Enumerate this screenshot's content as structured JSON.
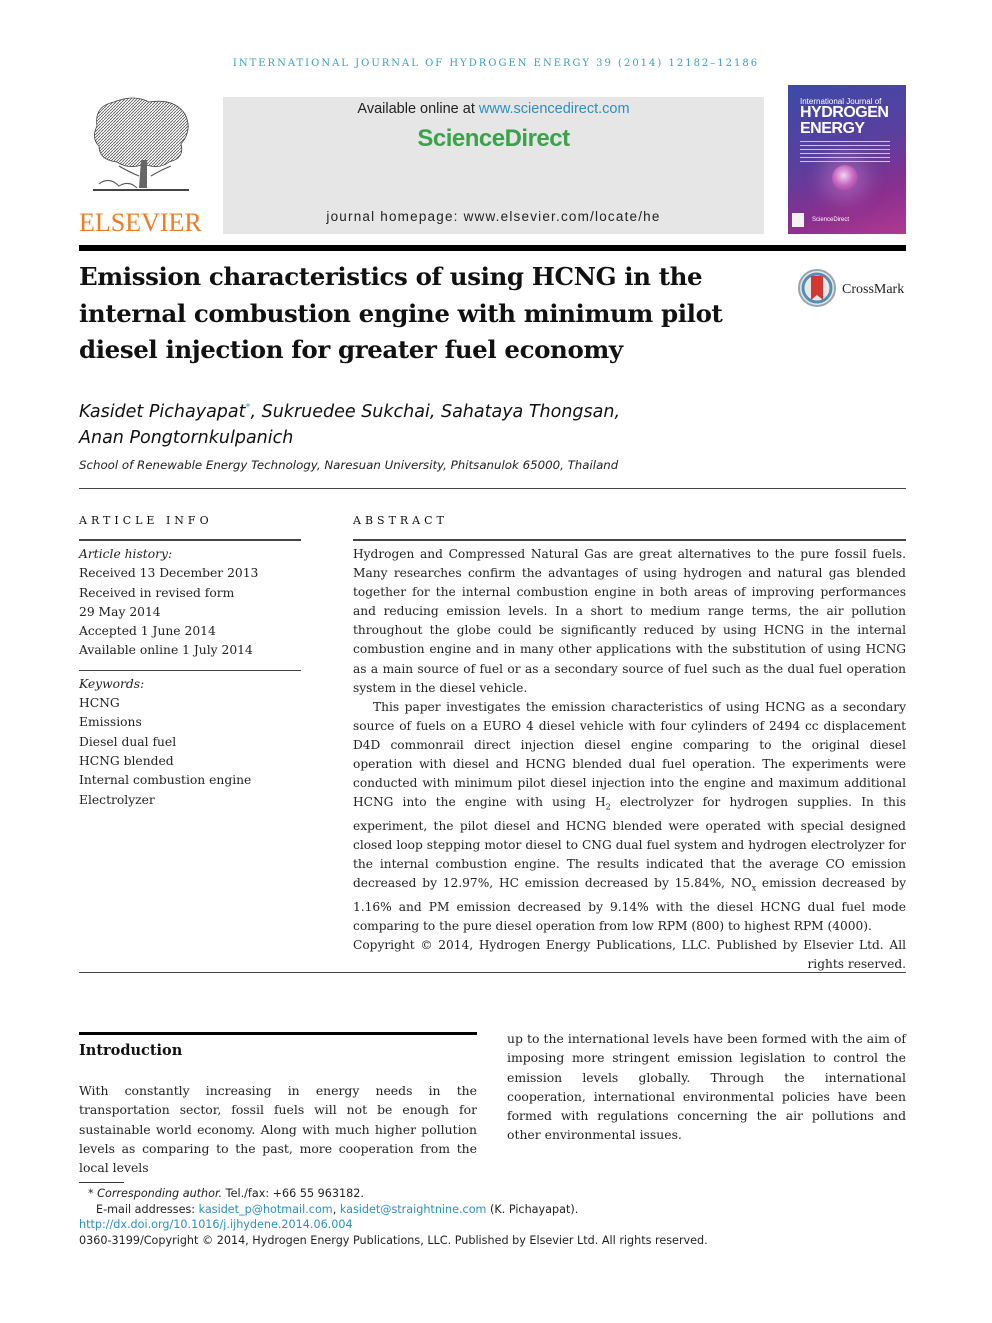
{
  "running_head": "International Journal of Hydrogen Energy 39 (2014) 12182–12186",
  "publisher": {
    "logo_word": "ELSEVIER",
    "available_online_prefix": "Available online at ",
    "available_online_link": "www.sciencedirect.com",
    "brand": "ScienceDirect",
    "journal_homepage": "journal homepage: www.elsevier.com/locate/he"
  },
  "cover": {
    "line1": "International Journal of",
    "line2": "HYDROGEN",
    "line3": "ENERGY",
    "footer": "ScienceDirect"
  },
  "crossmark": {
    "label": "CrossMark"
  },
  "article": {
    "title": "Emission characteristics of using HCNG in the internal combustion engine with minimum pilot diesel injection for greater fuel economy",
    "authors_line1_a": "Kasidet Pichayapat",
    "author_mark": "*",
    "authors_line1_b": ", Sukruedee Sukchai, Sahataya Thongsan,",
    "authors_line2": "Anan Pongtornkulpanich",
    "affiliation": "School of Renewable Energy Technology, Naresuan University, Phitsanulok 65000, Thailand"
  },
  "article_info": {
    "heading": "ARTICLE INFO",
    "history_label": "Article history:",
    "history": [
      "Received 13 December 2013",
      "Received in revised form",
      "29 May 2014",
      "Accepted 1 June 2014",
      "Available online 1 July 2014"
    ],
    "keywords_label": "Keywords:",
    "keywords": [
      "HCNG",
      "Emissions",
      "Diesel dual fuel",
      "HCNG blended",
      "Internal combustion engine",
      "Electrolyzer"
    ]
  },
  "abstract": {
    "heading": "ABSTRACT",
    "p1": "Hydrogen and Compressed Natural Gas are great alternatives to the pure fossil fuels. Many researches confirm the advantages of using hydrogen and natural gas blended together for the internal combustion engine in both areas of improving performances and reducing emission levels. In a short to medium range terms, the air pollution throughout the globe could be significantly reduced by using HCNG in the internal combustion engine and in many other applications with the substitution of using HCNG as a main source of fuel or as a secondary source of fuel such as the dual fuel operation system in the diesel vehicle.",
    "p2a": "This paper investigates the emission characteristics of using HCNG as a secondary source of fuels on a EURO 4 diesel vehicle with four cylinders of 2494 cc displacement D4D commonrail direct injection diesel engine comparing to the original diesel operation with diesel and HCNG blended dual fuel operation. The experiments were conducted with minimum pilot diesel injection into the engine and maximum additional HCNG into the engine with using H",
    "p2_sub1": "2",
    "p2b": " electrolyzer for hydrogen supplies. In this experiment, the pilot diesel and HCNG blended were operated with special designed closed loop stepping motor diesel to CNG dual fuel system and hydrogen electrolyzer for the internal combustion engine. The results indicated that the average CO emission decreased by 12.97%, HC emission decreased by 15.84%, NO",
    "p2_sub2": "x",
    "p2c": " emission decreased by 1.16% and PM emission decreased by 9.14% with the diesel HCNG dual fuel mode comparing to the pure diesel operation from low RPM (800) to highest RPM (4000).",
    "copyright": "Copyright © 2014, Hydrogen Energy Publications, LLC. Published by Elsevier Ltd. All rights reserved."
  },
  "introduction": {
    "heading": "Introduction",
    "left": "With constantly increasing in energy needs in the transportation sector, fossil fuels will not be enough for sustainable world economy. Along with much higher pollution levels as comparing to the past, more cooperation from the local levels",
    "right": "up to the international levels have been formed with the aim of imposing more stringent emission legislation to control the emission levels globally. Through the international cooperation, international environmental policies have been formed with regulations concerning the air pollutions and other environmental issues."
  },
  "footnotes": {
    "corresponding_mark": "*",
    "corresponding_label": "Corresponding author.",
    "tel": " Tel./fax: +66 55 963182.",
    "email_label": "E-mail addresses: ",
    "email1": "kasidet_p@hotmail.com",
    "email_sep": ", ",
    "email2": "kasidet@straightnine.com",
    "email_suffix": " (K. Pichayapat).",
    "doi": "http://dx.doi.org/10.1016/j.ijhydene.2014.06.004",
    "copyright": "0360-3199/Copyright © 2014, Hydrogen Energy Publications, LLC. Published by Elsevier Ltd. All rights reserved."
  }
}
